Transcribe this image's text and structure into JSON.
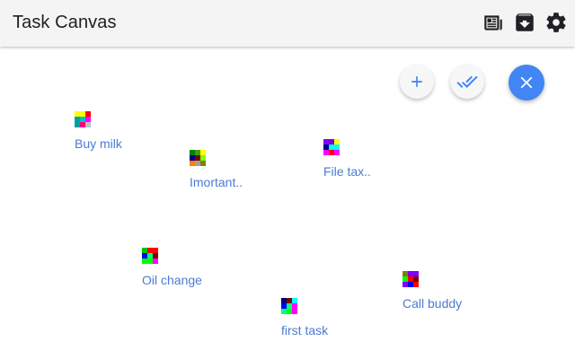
{
  "app": {
    "title": "Task Canvas"
  },
  "toolbar": {
    "icons": [
      "newspaper-icon",
      "archive-icon",
      "gear-icon"
    ]
  },
  "actions": {
    "add_icon": "plus-icon",
    "complete_icon": "done-all-icon",
    "close_icon": "close-icon",
    "accent_color": "#4285f4"
  },
  "tasks": [
    {
      "label": "Buy milk",
      "icon_colors": [
        "#ffff00",
        "#ffff00",
        "#ff0000",
        "#ffffff",
        "#00a0a0",
        "#00c0c0",
        "#ff00ff",
        "#ffffff",
        "#00a0a0",
        "#ff0080",
        "#c0c0c0",
        "#ffffff",
        "#ffffff",
        "#ffffff",
        "#ffffff",
        "#ffffff"
      ]
    },
    {
      "label": "Imortant..",
      "icon_colors": [
        "#008000",
        "#40a000",
        "#ffff00",
        "#ffffff",
        "#000080",
        "#800000",
        "#80ff00",
        "#ffffff",
        "#ff8000",
        "#a0a0a0",
        "#808000",
        "#ffffff",
        "#ffffff",
        "#ffffff",
        "#ffffff",
        "#ffffff"
      ]
    },
    {
      "label": "File tax..",
      "icon_colors": [
        "#8000ff",
        "#8000c0",
        "#ffff00",
        "#ffffff",
        "#000080",
        "#00ffff",
        "#00ffff",
        "#ffffff",
        "#ff00ff",
        "#ff0000",
        "#ff00ff",
        "#ffffff",
        "#ffffff",
        "#ffffff",
        "#ffffff",
        "#ffffff"
      ]
    },
    {
      "label": "Oil change",
      "icon_colors": [
        "#00c000",
        "#ff0000",
        "#ff0000",
        "#ffffff",
        "#0000ff",
        "#00ff80",
        "#800000",
        "#ffffff",
        "#00ff00",
        "#00ff00",
        "#ff00ff",
        "#ffffff",
        "#ffffff",
        "#ffffff",
        "#ffffff",
        "#ffffff"
      ]
    },
    {
      "label": "Call buddy",
      "icon_colors": [
        "#808000",
        "#8000ff",
        "#8000ff",
        "#ffffff",
        "#00ff00",
        "#ff0000",
        "#800000",
        "#ffffff",
        "#8000ff",
        "#0000ff",
        "#ff0000",
        "#ffffff",
        "#ffffff",
        "#ffffff",
        "#ffffff",
        "#ffffff"
      ]
    },
    {
      "label": "first task",
      "icon_colors": [
        "#000080",
        "#800000",
        "#00ffff",
        "#ffffff",
        "#0000ff",
        "#00ff80",
        "#ff00ff",
        "#ffffff",
        "#00ff80",
        "#00ff00",
        "#ff00ff",
        "#ffffff",
        "#ffffff",
        "#ffffff",
        "#ffffff",
        "#ffffff"
      ]
    }
  ]
}
